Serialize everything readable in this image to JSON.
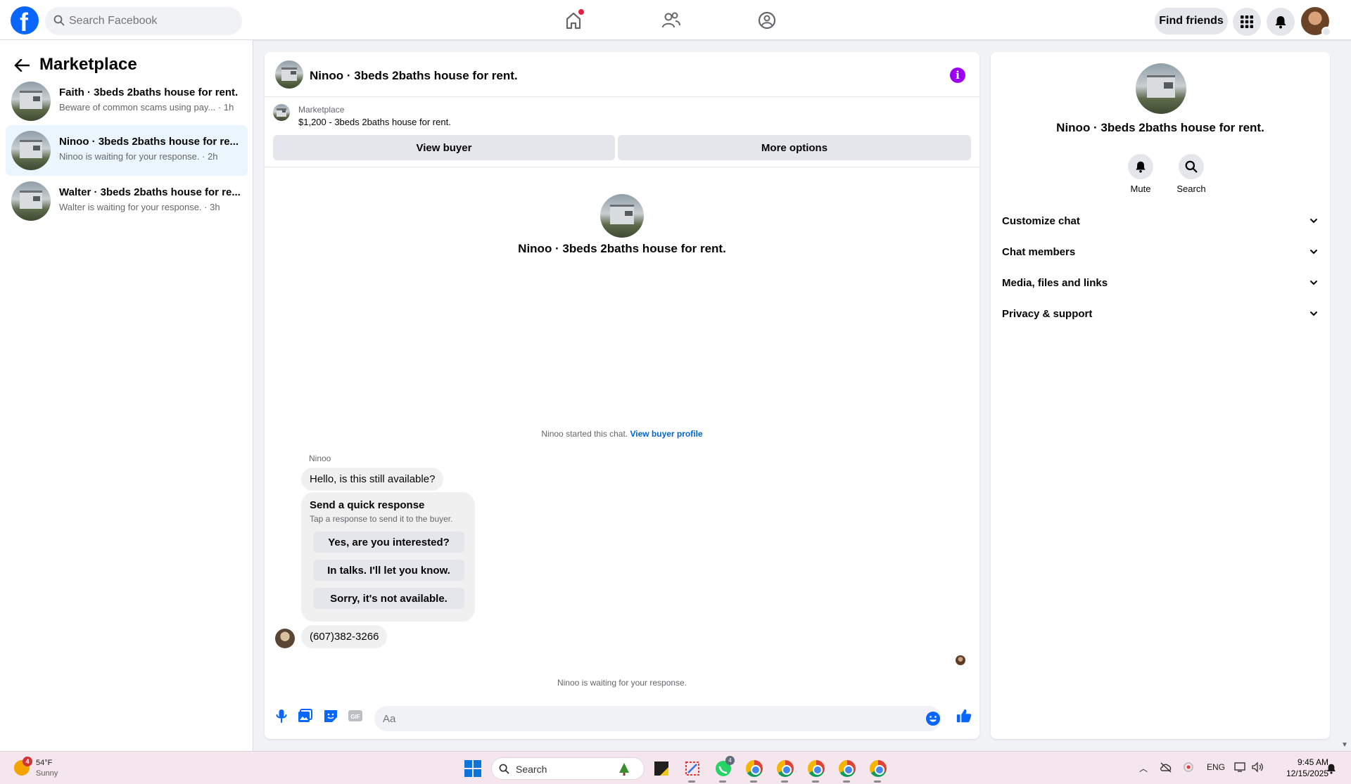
{
  "topnav": {
    "search_placeholder": "Search Facebook",
    "find_friends_label": "Find friends"
  },
  "sidebar": {
    "title": "Marketplace",
    "conversations": [
      {
        "title": "Faith · 3beds 2baths house for rent.",
        "subtitle": "Beware of common scams using pay... · 1h",
        "active": false
      },
      {
        "title": "Ninoo · 3beds 2baths house for re...",
        "subtitle": "Ninoo is waiting for your response. · 2h",
        "active": true
      },
      {
        "title": "Walter · 3beds 2baths house for re...",
        "subtitle": "Walter is waiting for your response. · 3h",
        "active": false
      }
    ]
  },
  "chat": {
    "title": "Ninoo · 3beds 2baths house for rent.",
    "marketplace_label": "Marketplace",
    "listing": "$1,200 - 3beds 2baths house for rent.",
    "view_buyer_label": "View buyer",
    "more_options_label": "More options",
    "intro_name": "Ninoo · 3beds 2baths house for rent.",
    "started_text": "Ninoo started this chat.",
    "view_profile_link": "View buyer profile",
    "sender_name": "Ninoo",
    "message_1": "Hello, is this still available?",
    "quick_response": {
      "title": "Send a quick response",
      "subtitle": "Tap a response to send it to the buyer.",
      "options": [
        "Yes, are you interested?",
        "In talks. I'll let you know.",
        "Sorry, it's not available."
      ]
    },
    "message_2": "(607)382-3266",
    "waiting_text": "Ninoo is waiting for your response.",
    "composer_placeholder": "Aa"
  },
  "details": {
    "name": "Ninoo · 3beds 2baths house for rent.",
    "mute_label": "Mute",
    "search_label": "Search",
    "sections": [
      "Customize chat",
      "Chat members",
      "Media, files and links",
      "Privacy & support"
    ]
  },
  "taskbar": {
    "weather_temp": "54°F",
    "weather_desc": "Sunny",
    "weather_badge": "4",
    "search_label": "Search",
    "whatsapp_badge": "4",
    "lang": "ENG",
    "time": "9:45 AM",
    "date": "12/15/2025"
  },
  "colors": {
    "brand": "#0866ff",
    "accent_purple": "#9b00f5",
    "link": "#0064d1",
    "active_conversation": "#ebf5ff"
  },
  "icons": [
    "facebook-logo",
    "search-icon",
    "home-icon",
    "friends-icon",
    "groups-icon",
    "apps-grid-icon",
    "bell-icon",
    "back-arrow-icon",
    "info-icon",
    "mic-icon",
    "image-icon",
    "sticker-icon",
    "gif-icon",
    "emoji-icon",
    "like-icon",
    "chevron-down-icon"
  ]
}
